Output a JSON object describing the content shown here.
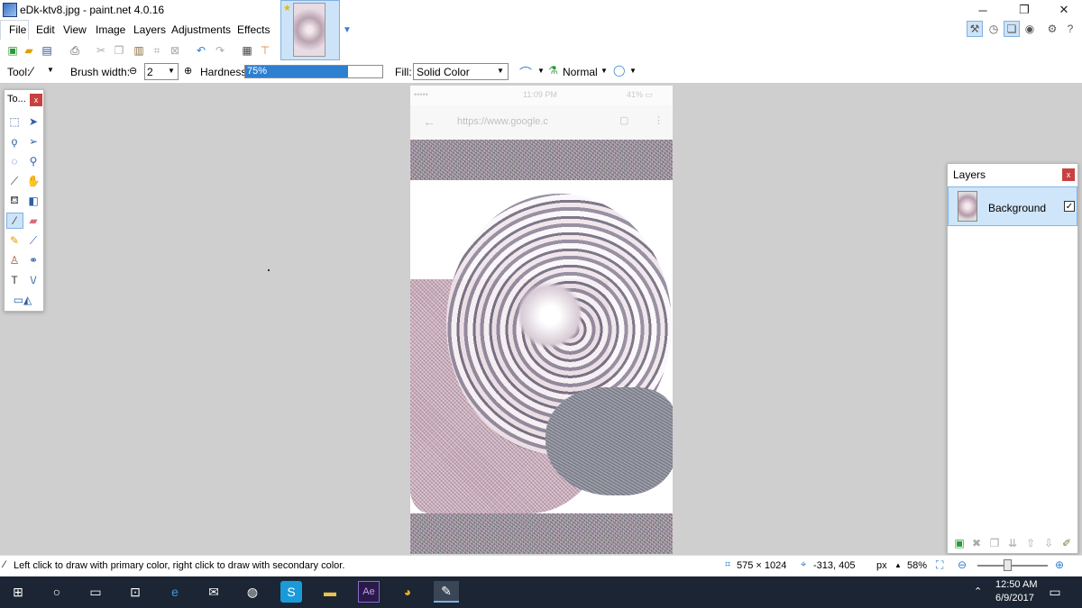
{
  "window": {
    "title": "eDk-ktv8.jpg - paint.net 4.0.16",
    "minimize": "─",
    "restore": "❐",
    "close": "✕"
  },
  "menu": [
    "File",
    "Edit",
    "View",
    "Image",
    "Layers",
    "Adjustments",
    "Effects"
  ],
  "toolbar": {
    "tool_label": "Tool:",
    "brush_width_label": "Brush width:",
    "brush_width_value": "2",
    "hardness_label": "Hardness:",
    "hardness_value": "75%",
    "hardness_percent": 75,
    "fill_label": "Fill:",
    "fill_value": "Solid Color",
    "blend_mode": "Normal"
  },
  "image_content": {
    "status_time": "11:09 PM",
    "status_left": "•••••  ",
    "status_right": "41% ▭",
    "url": "https://www.google.c"
  },
  "tools_window": {
    "title": "To...",
    "close": "x",
    "tools": [
      "rectangle-select-icon",
      "move-selection-icon",
      "lasso-select-icon",
      "move-selection-alt-icon",
      "ellipse-select-icon",
      "zoom-icon",
      "magic-wand-icon",
      "pan-hand-icon",
      "paint-bucket-icon",
      "gradient-icon",
      "paintbrush-icon",
      "eraser-icon",
      "pencil-icon",
      "color-picker-icon",
      "clone-stamp-icon",
      "recolor-icon",
      "text-icon",
      "line-curve-icon",
      "shapes-icon"
    ]
  },
  "layers_window": {
    "title": "Layers",
    "close": "x",
    "layers": [
      {
        "name": "Background",
        "visible": "✓"
      }
    ]
  },
  "statusbar": {
    "hint": "Left click to draw with primary color, right click to draw with secondary color.",
    "image_size": "575 × 1024",
    "cursor_pos": "-313, 405",
    "units": "px",
    "zoom": "58%"
  },
  "taskbar": {
    "time": "12:50 AM",
    "date": "6/9/2017"
  },
  "colors": {
    "accent": "#2f7fd1",
    "canvas_bg": "#cfcfcf",
    "taskbar": "#1b2533",
    "close_red": "#c84040",
    "selected_layer": "#cfe5f9"
  }
}
